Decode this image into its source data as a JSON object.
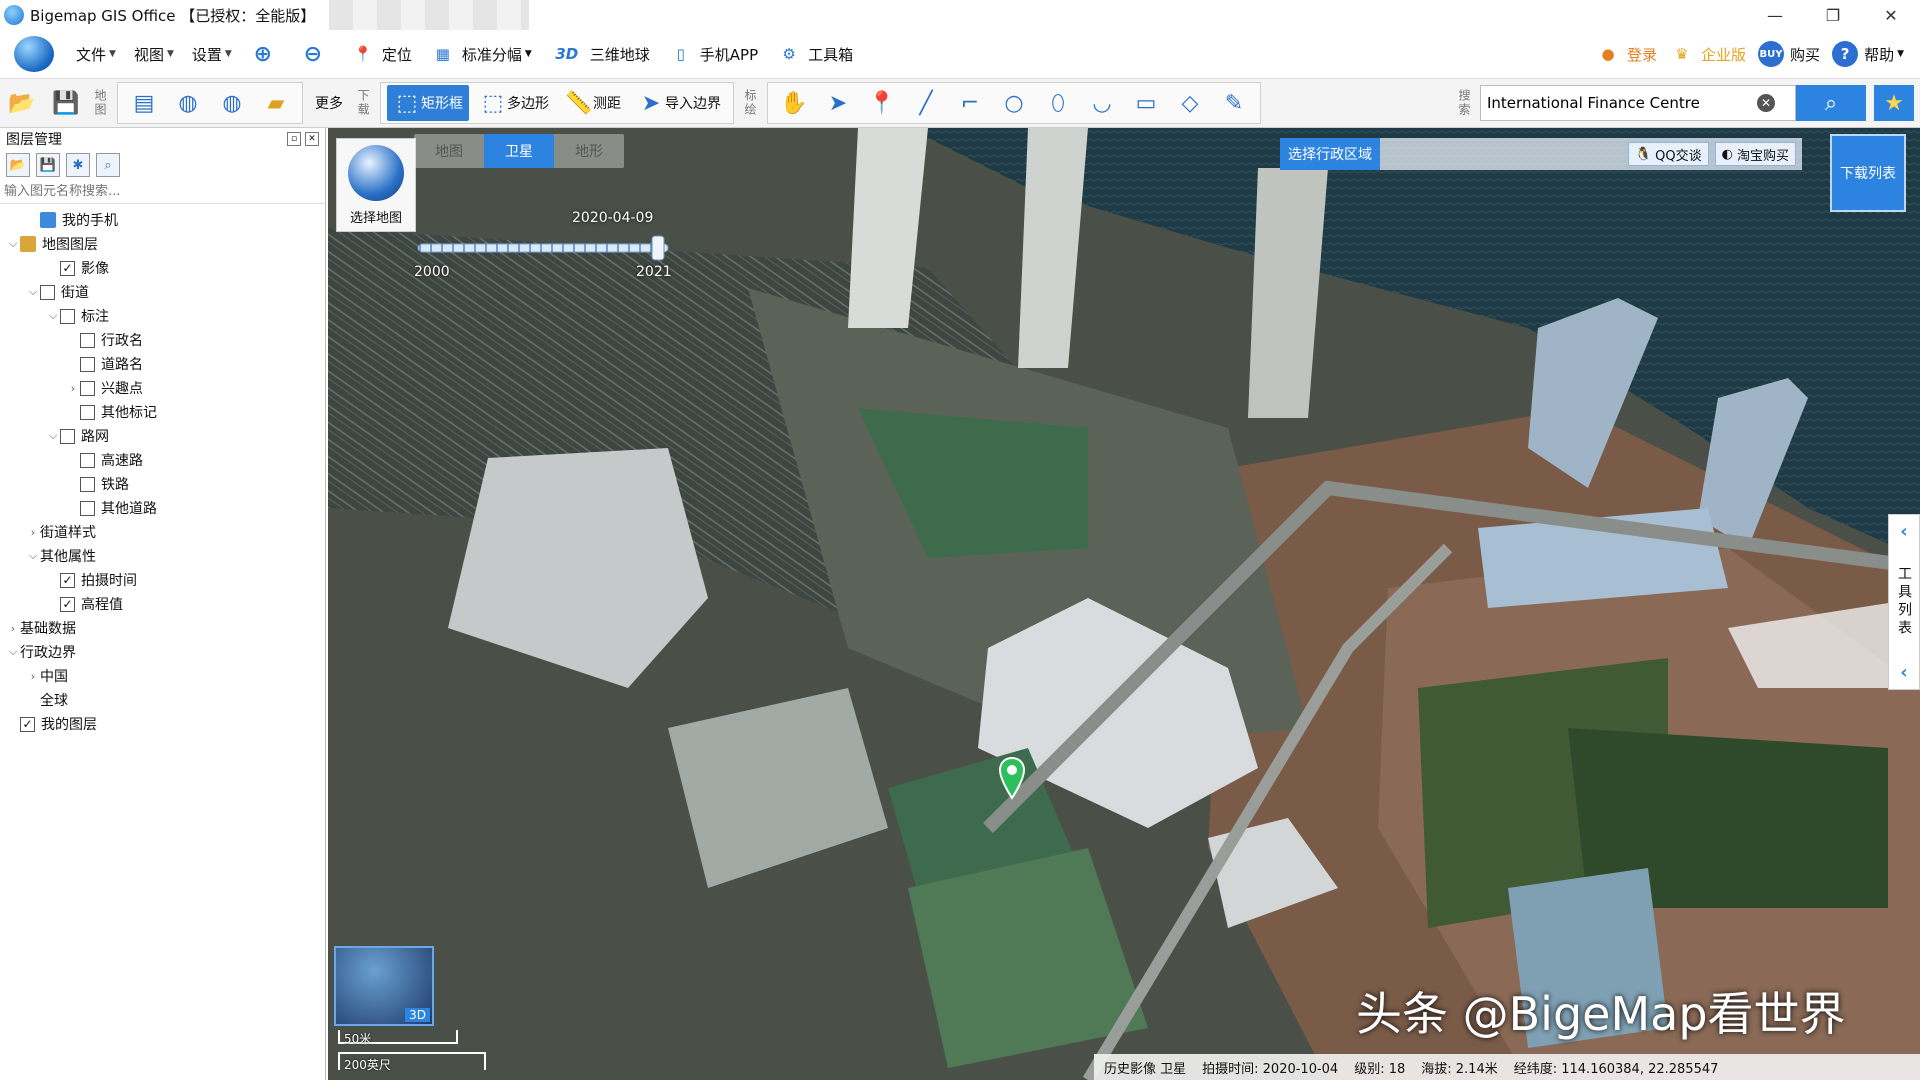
{
  "window": {
    "title": "Bigemap GIS Office 【已授权：全能版】",
    "controls": [
      "—",
      "❐",
      "✕"
    ]
  },
  "menubar": {
    "menus": [
      {
        "label": "文件",
        "icon": "file-icon"
      },
      {
        "label": "视图",
        "icon": "view-icon"
      },
      {
        "label": "设置",
        "icon": "settings-icon"
      }
    ],
    "items": [
      {
        "label": "定位",
        "icon": "location-pin-icon"
      },
      {
        "label": "标准分幅",
        "icon": "grid-icon"
      },
      {
        "label": "三维地球",
        "icon": "3d-icon"
      },
      {
        "label": "手机APP",
        "icon": "phone-icon"
      },
      {
        "label": "工具箱",
        "icon": "gear-icon"
      }
    ],
    "right": [
      {
        "label": "登录",
        "icon": "user-icon",
        "color": "#e87d1e"
      },
      {
        "label": "企业版",
        "icon": "enterprise-icon",
        "color": "#e8a31e"
      },
      {
        "label": "购买",
        "icon": "buy-icon",
        "color": "#111111"
      },
      {
        "label": "帮助",
        "icon": "help-icon",
        "color": "#111111"
      }
    ]
  },
  "toolbar": {
    "map_label": "地图",
    "more": "更多",
    "download_label": "下载",
    "mark_label": "标绘",
    "search_label": "搜索",
    "rect": "矩形框",
    "polygon": "多边形",
    "measure": "测距",
    "import_border": "导入边界",
    "search_value": "International Finance Centre"
  },
  "left_panel": {
    "title": "图层管理",
    "search_placeholder": "输入图元名称搜索..."
  },
  "tree": [
    {
      "label": "我的手机",
      "level": 1,
      "expander": "",
      "checkbox": null,
      "icon": "phone-icon"
    },
    {
      "label": "地图图层",
      "level": 0,
      "expander": "v",
      "checkbox": null,
      "icon": "layers-icon"
    },
    {
      "label": "影像",
      "level": 2,
      "expander": "",
      "checkbox": true
    },
    {
      "label": "街道",
      "level": 1,
      "expander": "v",
      "checkbox": false
    },
    {
      "label": "标注",
      "level": 2,
      "expander": "v",
      "checkbox": false
    },
    {
      "label": "行政名",
      "level": 3,
      "expander": "",
      "checkbox": false
    },
    {
      "label": "道路名",
      "level": 3,
      "expander": "",
      "checkbox": false
    },
    {
      "label": "兴趣点",
      "level": 3,
      "expander": ">",
      "checkbox": false
    },
    {
      "label": "其他标记",
      "level": 3,
      "expander": "",
      "checkbox": false
    },
    {
      "label": "路网",
      "level": 2,
      "expander": "v",
      "checkbox": false
    },
    {
      "label": "高速路",
      "level": 3,
      "expander": "",
      "checkbox": false
    },
    {
      "label": "铁路",
      "level": 3,
      "expander": "",
      "checkbox": false
    },
    {
      "label": "其他道路",
      "level": 3,
      "expander": "",
      "checkbox": false
    },
    {
      "label": "街道样式",
      "level": 1,
      "expander": ">",
      "checkbox": null
    },
    {
      "label": "其他属性",
      "level": 1,
      "expander": "v",
      "checkbox": null
    },
    {
      "label": "拍摄时间",
      "level": 2,
      "expander": "",
      "checkbox": true
    },
    {
      "label": "高程值",
      "level": 2,
      "expander": "",
      "checkbox": true
    },
    {
      "label": "基础数据",
      "level": 0,
      "expander": ">",
      "checkbox": null
    },
    {
      "label": "行政边界",
      "level": 0,
      "expander": "v",
      "checkbox": null
    },
    {
      "label": "中国",
      "level": 1,
      "expander": ">",
      "checkbox": null
    },
    {
      "label": "全球",
      "level": 1,
      "expander": "",
      "checkbox": null
    },
    {
      "label": "我的图层",
      "level": 0,
      "expander": "",
      "checkbox": true
    }
  ],
  "map": {
    "tabs": [
      {
        "label": "地图",
        "active": false
      },
      {
        "label": "卫星",
        "active": true
      },
      {
        "label": "地形",
        "active": false
      }
    ],
    "select_map": "选择地图",
    "timeline": {
      "current": "2020-04-09",
      "start": "2000",
      "end": "2021",
      "position": 0.96
    },
    "admin_region": "选择行政区域",
    "qq": "QQ交谈",
    "taobao": "淘宝购买",
    "download_list": "下载列表",
    "tool_list": "工具列表",
    "minimap_3d": "3D",
    "scale_top": "50米",
    "scale_bottom": "200英尺",
    "watermark": "头条 @BigeMap看世界",
    "status": {
      "source": "历史影像 卫星",
      "capture_time": "拍摄时间: 2020-10-04",
      "level": "级别:  18",
      "altitude": "海拔: 2.14米",
      "coords": "经纬度:  114.160384, 22.285547"
    }
  }
}
